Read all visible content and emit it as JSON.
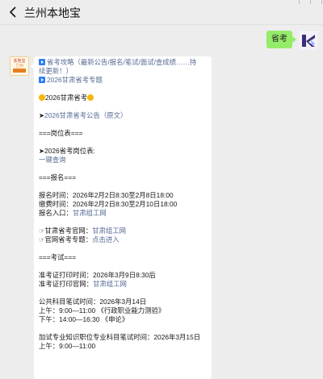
{
  "header": {
    "title": "兰州本地宝"
  },
  "my_message": {
    "text": "省考"
  },
  "bot": {
    "avatar_text_1": "本地宝",
    "avatar_text_2": "兰州"
  },
  "message": {
    "l1a": "省考攻略（最新公告/报名/笔试/面试/查成绩……持",
    "l1b": "续更新！）",
    "l2": "2026甘肃省考专题",
    "l3": "2026甘肃省考",
    "l4_arrow": "➤",
    "l4_link": "2026甘肃省考公告（原文）",
    "l5": "===岗位表===",
    "l6": "➤2026省考岗位表:",
    "l7": "一键查询",
    "l8": "===报名===",
    "l9": "报名时间：2026年2月2日8:30至2月8日18:00",
    "l10": "缴费时间：2026年2月2日8:30至2月10日18:00",
    "l11_label": "报名入口：",
    "l11_link": "甘肃组工网",
    "l12_label": "☞甘肃省考官网：",
    "l12_link": "甘肃组工网",
    "l13_label": "☞官网省考专题：",
    "l13_link": "点击进入",
    "l14": "===考试===",
    "l15": "准考证打印时间：2026年3月9日8:30后",
    "l16_label": "准考证打印官网：",
    "l16_link": "甘肃组工网",
    "l17": "公共科目笔试时间：2026年3月14日",
    "l18": "上午：9:00—11:00 《行政职业能力测验》",
    "l19": "下午：14:00—16:30 《申论》",
    "l20": "加试专业知识职位专业科目笔试时间：2026年3月15日",
    "l21": "上午：9:00—11:00"
  },
  "colors": {
    "link": "#576b95",
    "bubble_self": "#95ec69",
    "accent_icon": "#2d7ef7",
    "sun": "#f5b80a"
  }
}
